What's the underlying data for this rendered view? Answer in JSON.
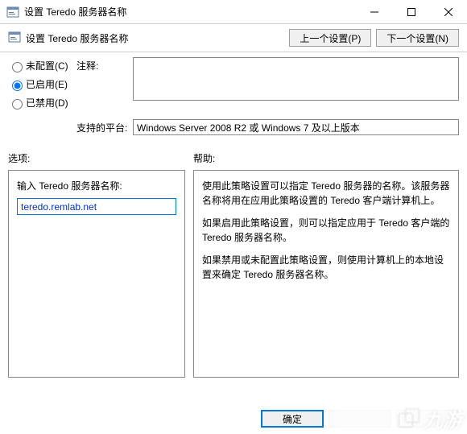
{
  "window": {
    "title": "设置 Teredo 服务器名称"
  },
  "ribbon": {
    "title": "设置 Teredo 服务器名称",
    "prev_btn": "上一个设置(P)",
    "next_btn": "下一个设置(N)"
  },
  "radios": {
    "not_configured": "未配置(C)",
    "enabled": "已启用(E)",
    "disabled": "已禁用(D)"
  },
  "labels": {
    "comment": "注释:",
    "supported": "支持的平台:",
    "options": "选项:",
    "help": "帮助:",
    "input_label": "输入 Teredo 服务器名称:"
  },
  "fields": {
    "comment_value": "",
    "supported_value": "Windows Server 2008 R2 或 Windows 7 及以上版本",
    "server_name_value": "teredo.remlab.net"
  },
  "help_text": {
    "p1": "使用此策略设置可以指定 Teredo 服务器的名称。该服务器名称将用在应用此策略设置的 Teredo 客户端计算机上。",
    "p2": "如果启用此策略设置，则可以指定应用于 Teredo 客户端的 Teredo 服务器名称。",
    "p3": "如果禁用或未配置此策略设置，则使用计算机上的本地设置来确定 Teredo 服务器名称。"
  },
  "footer": {
    "ok": "确定",
    "cancel": "",
    "apply": ""
  },
  "watermark": "九游"
}
